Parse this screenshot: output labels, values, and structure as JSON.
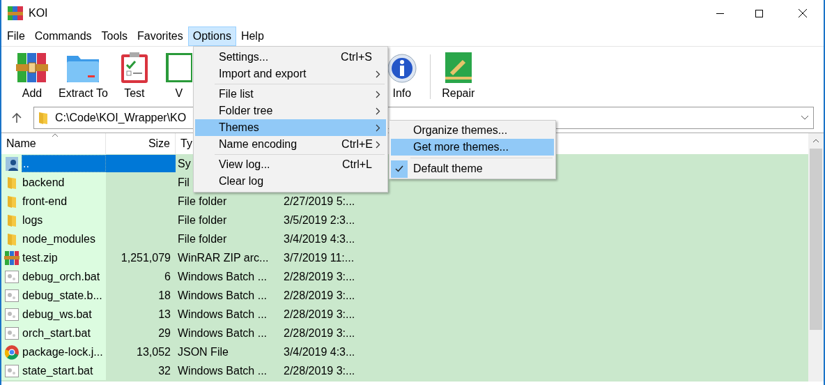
{
  "window": {
    "title": "KOI"
  },
  "menubar": [
    {
      "label": "File",
      "selected": false
    },
    {
      "label": "Commands",
      "selected": false
    },
    {
      "label": "Tools",
      "selected": false
    },
    {
      "label": "Favorites",
      "selected": false
    },
    {
      "label": "Options",
      "selected": true
    },
    {
      "label": "Help",
      "selected": false
    }
  ],
  "toolbar": [
    {
      "kind": "add",
      "label": "Add"
    },
    {
      "kind": "extract",
      "label": "Extract To"
    },
    {
      "kind": "test",
      "label": "Test"
    },
    {
      "kind": "view",
      "label": "V"
    },
    {
      "kind": "gap"
    },
    {
      "kind": "info",
      "label": "Info"
    },
    {
      "kind": "separator"
    },
    {
      "kind": "repair",
      "label": "Repair"
    }
  ],
  "address": {
    "value": "C:\\Code\\KOI_Wrapper\\KO"
  },
  "table": {
    "columns": [
      "Name",
      "Size",
      "Ty"
    ],
    "rows": [
      {
        "kind": "parent",
        "name": "..",
        "size": "",
        "type": "Sy",
        "date": "",
        "selected": true
      },
      {
        "kind": "folder",
        "name": "backend",
        "size": "",
        "type": "Fil",
        "date": "",
        "selected": false
      },
      {
        "kind": "folder",
        "name": "front-end",
        "size": "",
        "type": "File folder",
        "date": "2/27/2019 5:...",
        "selected": false
      },
      {
        "kind": "folder",
        "name": "logs",
        "size": "",
        "type": "File folder",
        "date": "3/5/2019 2:3...",
        "selected": false
      },
      {
        "kind": "folder",
        "name": "node_modules",
        "size": "",
        "type": "File folder",
        "date": "3/4/2019 4:3...",
        "selected": false
      },
      {
        "kind": "zip",
        "name": "test.zip",
        "size": "1,251,079",
        "type": "WinRAR ZIP arc...",
        "date": "3/7/2019 11:...",
        "selected": false
      },
      {
        "kind": "batch",
        "name": "debug_orch.bat",
        "size": "6",
        "type": "Windows Batch ...",
        "date": "2/28/2019 3:...",
        "selected": false
      },
      {
        "kind": "batch",
        "name": "debug_state.b...",
        "size": "18",
        "type": "Windows Batch ...",
        "date": "2/28/2019 3:...",
        "selected": false
      },
      {
        "kind": "batch",
        "name": "debug_ws.bat",
        "size": "13",
        "type": "Windows Batch ...",
        "date": "2/28/2019 3:...",
        "selected": false
      },
      {
        "kind": "batch",
        "name": "orch_start.bat",
        "size": "29",
        "type": "Windows Batch ...",
        "date": "2/28/2019 3:...",
        "selected": false
      },
      {
        "kind": "browser",
        "name": "package-lock.j...",
        "size": "13,052",
        "type": "JSON File",
        "date": "3/4/2019 4:3...",
        "selected": false
      },
      {
        "kind": "batch",
        "name": "state_start.bat",
        "size": "32",
        "type": "Windows Batch ...",
        "date": "2/28/2019 3:...",
        "selected": false
      }
    ]
  },
  "options_menu": [
    {
      "kind": "item",
      "label": "Settings...",
      "shortcut": "Ctrl+S",
      "submenu": false,
      "selected": false
    },
    {
      "kind": "item",
      "label": "Import and export",
      "submenu": true,
      "selected": false
    },
    {
      "kind": "separator"
    },
    {
      "kind": "item",
      "label": "File list",
      "submenu": true,
      "selected": false
    },
    {
      "kind": "item",
      "label": "Folder tree",
      "submenu": true,
      "selected": false
    },
    {
      "kind": "item",
      "label": "Themes",
      "submenu": true,
      "selected": true
    },
    {
      "kind": "item",
      "label": "Name encoding",
      "shortcut": "Ctrl+E",
      "submenu": true,
      "selected": false
    },
    {
      "kind": "separator"
    },
    {
      "kind": "item",
      "label": "View log...",
      "shortcut": "Ctrl+L",
      "submenu": false,
      "selected": false
    },
    {
      "kind": "item",
      "label": "Clear log",
      "submenu": false,
      "selected": false
    }
  ],
  "themes_menu": [
    {
      "kind": "item",
      "label": "Organize themes...",
      "checked": false,
      "selected": false
    },
    {
      "kind": "item",
      "label": "Get more themes...",
      "checked": false,
      "selected": true
    },
    {
      "kind": "separator"
    },
    {
      "kind": "item",
      "label": "Default theme",
      "checked": true,
      "selected": false
    }
  ]
}
